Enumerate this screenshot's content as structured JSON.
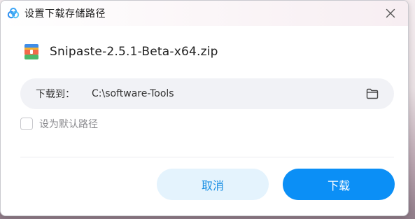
{
  "window": {
    "title": "设置下载存储路径",
    "app_icon": "baidu-netdisk-cloud-icon",
    "close_icon": "close-icon"
  },
  "file": {
    "icon": "zip-archive-icon",
    "name": "Snipaste-2.5.1-Beta-x64.zip"
  },
  "download_path": {
    "label": "下载到：",
    "value": "C:\\software-Tools",
    "folder_icon": "folder-icon"
  },
  "default_option": {
    "label": "设为默认路径",
    "checked": false
  },
  "buttons": {
    "cancel": "取消",
    "download": "下载"
  },
  "colors": {
    "primary": "#0b8ff6",
    "primary_light": "#e4f3fd",
    "path_box_bg": "#f1f2f6"
  }
}
